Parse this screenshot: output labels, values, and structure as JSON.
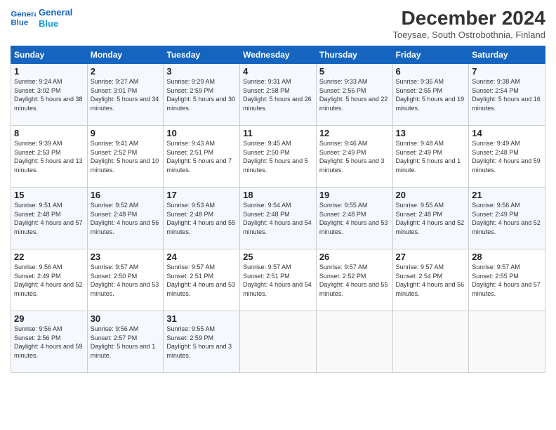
{
  "header": {
    "logo_line1": "General",
    "logo_line2": "Blue",
    "title": "December 2024",
    "subtitle": "Toeysae, South Ostrobothnia, Finland"
  },
  "columns": [
    "Sunday",
    "Monday",
    "Tuesday",
    "Wednesday",
    "Thursday",
    "Friday",
    "Saturday"
  ],
  "weeks": [
    [
      {
        "day": 1,
        "sunrise": "9:24 AM",
        "sunset": "3:02 PM",
        "daylight": "5 hours and 38 minutes."
      },
      {
        "day": 2,
        "sunrise": "9:27 AM",
        "sunset": "3:01 PM",
        "daylight": "5 hours and 34 minutes."
      },
      {
        "day": 3,
        "sunrise": "9:29 AM",
        "sunset": "2:59 PM",
        "daylight": "5 hours and 30 minutes."
      },
      {
        "day": 4,
        "sunrise": "9:31 AM",
        "sunset": "2:58 PM",
        "daylight": "5 hours and 26 minutes."
      },
      {
        "day": 5,
        "sunrise": "9:33 AM",
        "sunset": "2:56 PM",
        "daylight": "5 hours and 22 minutes."
      },
      {
        "day": 6,
        "sunrise": "9:35 AM",
        "sunset": "2:55 PM",
        "daylight": "5 hours and 19 minutes."
      },
      {
        "day": 7,
        "sunrise": "9:38 AM",
        "sunset": "2:54 PM",
        "daylight": "5 hours and 16 minutes."
      }
    ],
    [
      {
        "day": 8,
        "sunrise": "9:39 AM",
        "sunset": "2:53 PM",
        "daylight": "5 hours and 13 minutes."
      },
      {
        "day": 9,
        "sunrise": "9:41 AM",
        "sunset": "2:52 PM",
        "daylight": "5 hours and 10 minutes."
      },
      {
        "day": 10,
        "sunrise": "9:43 AM",
        "sunset": "2:51 PM",
        "daylight": "5 hours and 7 minutes."
      },
      {
        "day": 11,
        "sunrise": "9:45 AM",
        "sunset": "2:50 PM",
        "daylight": "5 hours and 5 minutes."
      },
      {
        "day": 12,
        "sunrise": "9:46 AM",
        "sunset": "2:49 PM",
        "daylight": "5 hours and 3 minutes."
      },
      {
        "day": 13,
        "sunrise": "9:48 AM",
        "sunset": "2:49 PM",
        "daylight": "5 hours and 1 minute."
      },
      {
        "day": 14,
        "sunrise": "9:49 AM",
        "sunset": "2:48 PM",
        "daylight": "4 hours and 59 minutes."
      }
    ],
    [
      {
        "day": 15,
        "sunrise": "9:51 AM",
        "sunset": "2:48 PM",
        "daylight": "4 hours and 57 minutes."
      },
      {
        "day": 16,
        "sunrise": "9:52 AM",
        "sunset": "2:48 PM",
        "daylight": "4 hours and 56 minutes."
      },
      {
        "day": 17,
        "sunrise": "9:53 AM",
        "sunset": "2:48 PM",
        "daylight": "4 hours and 55 minutes."
      },
      {
        "day": 18,
        "sunrise": "9:54 AM",
        "sunset": "2:48 PM",
        "daylight": "4 hours and 54 minutes."
      },
      {
        "day": 19,
        "sunrise": "9:55 AM",
        "sunset": "2:48 PM",
        "daylight": "4 hours and 53 minutes."
      },
      {
        "day": 20,
        "sunrise": "9:55 AM",
        "sunset": "2:48 PM",
        "daylight": "4 hours and 52 minutes."
      },
      {
        "day": 21,
        "sunrise": "9:56 AM",
        "sunset": "2:49 PM",
        "daylight": "4 hours and 52 minutes."
      }
    ],
    [
      {
        "day": 22,
        "sunrise": "9:56 AM",
        "sunset": "2:49 PM",
        "daylight": "4 hours and 52 minutes."
      },
      {
        "day": 23,
        "sunrise": "9:57 AM",
        "sunset": "2:50 PM",
        "daylight": "4 hours and 53 minutes."
      },
      {
        "day": 24,
        "sunrise": "9:57 AM",
        "sunset": "2:51 PM",
        "daylight": "4 hours and 53 minutes."
      },
      {
        "day": 25,
        "sunrise": "9:57 AM",
        "sunset": "2:51 PM",
        "daylight": "4 hours and 54 minutes."
      },
      {
        "day": 26,
        "sunrise": "9:57 AM",
        "sunset": "2:52 PM",
        "daylight": "4 hours and 55 minutes."
      },
      {
        "day": 27,
        "sunrise": "9:57 AM",
        "sunset": "2:54 PM",
        "daylight": "4 hours and 56 minutes."
      },
      {
        "day": 28,
        "sunrise": "9:57 AM",
        "sunset": "2:55 PM",
        "daylight": "4 hours and 57 minutes."
      }
    ],
    [
      {
        "day": 29,
        "sunrise": "9:56 AM",
        "sunset": "2:56 PM",
        "daylight": "4 hours and 59 minutes."
      },
      {
        "day": 30,
        "sunrise": "9:56 AM",
        "sunset": "2:57 PM",
        "daylight": "5 hours and 1 minute."
      },
      {
        "day": 31,
        "sunrise": "9:55 AM",
        "sunset": "2:59 PM",
        "daylight": "5 hours and 3 minutes."
      },
      null,
      null,
      null,
      null
    ]
  ],
  "labels": {
    "sunrise": "Sunrise: ",
    "sunset": "Sunset: ",
    "daylight": "Daylight: "
  }
}
